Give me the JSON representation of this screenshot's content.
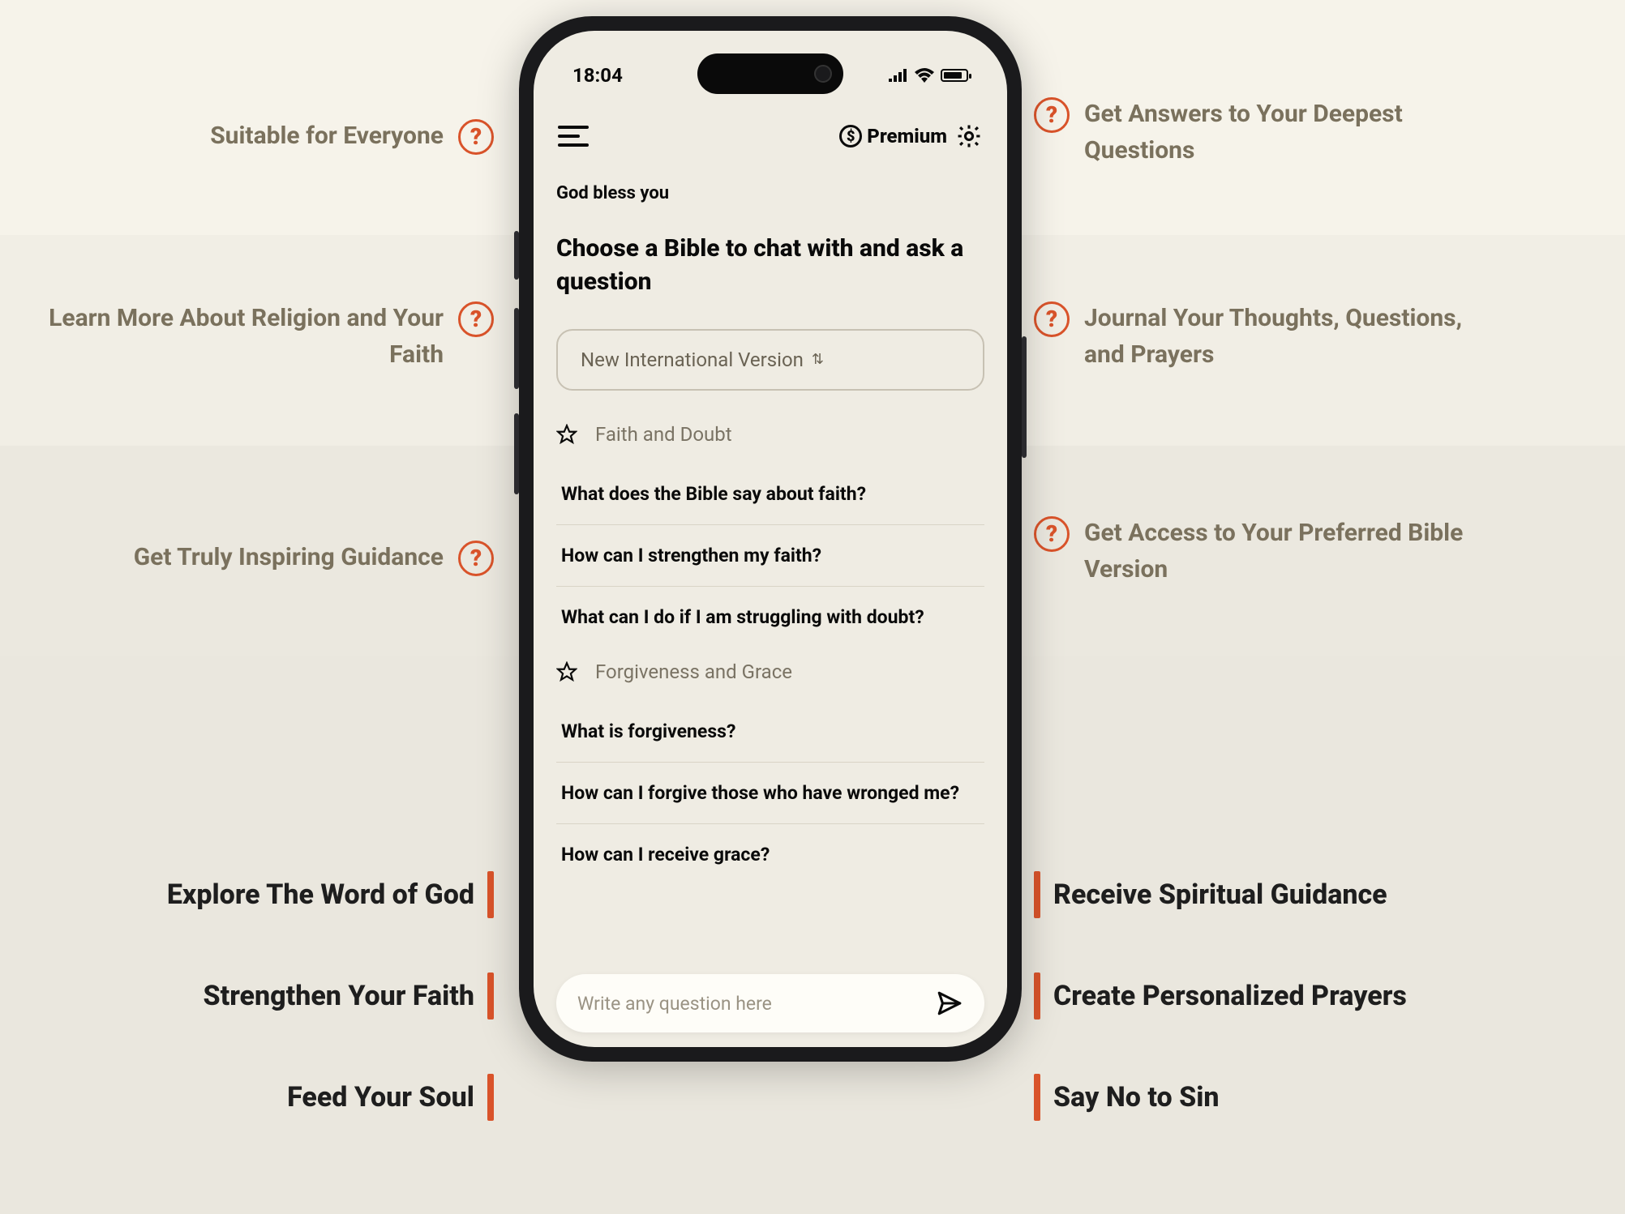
{
  "left_callouts": [
    "Suitable for Everyone",
    "Learn More About Religion and Your Faith",
    "Get Truly Inspiring Guidance"
  ],
  "right_callouts": [
    "Get Answers to Your Deepest Questions",
    "Journal Your Thoughts, Questions, and Prayers",
    "Get Access to Your Preferred Bible Version"
  ],
  "left_bars": [
    "Explore The Word of God",
    "Strengthen Your Faith",
    "Feed Your Soul"
  ],
  "right_bars": [
    "Receive Spiritual Guidance",
    "Create Personalized Prayers",
    "Say No to Sin"
  ],
  "phone": {
    "time": "18:04",
    "premium_label": "Premium",
    "greeting": "God bless you",
    "heading": "Choose a Bible to chat with and ask a question",
    "bible_version": "New International Version",
    "categories": [
      {
        "name": "Faith and Doubt",
        "questions": [
          "What does the Bible say about faith?",
          "How can I strengthen my faith?",
          "What can I do if I am struggling with doubt?"
        ]
      },
      {
        "name": "Forgiveness and Grace",
        "questions": [
          "What is forgiveness?",
          "How can I forgive those who have wronged me?",
          "How can I receive grace?"
        ]
      }
    ],
    "input_placeholder": "Write any question here"
  }
}
